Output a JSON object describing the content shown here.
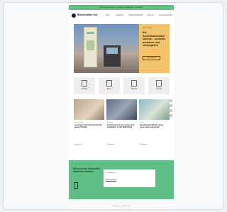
{
  "site": {
    "top_banner": "Barrierefreiheit · Leichte Sprache · Kontakt",
    "logo_text": "Bücherhallen Ost",
    "nav": [
      "Start",
      "Angebote",
      "Digitale Bibliothek",
      "Über uns",
      "Veranstaltungen"
    ]
  },
  "hero": {
    "kicker": "Neu im Haus",
    "title": "Die Ausleihautomaten sind da – schneller ausleihen und zurückgeben",
    "button": "Mehr erfahren"
  },
  "tiles": [
    {
      "label": "Katalog",
      "icon": "book-icon"
    },
    {
      "label": "Konto",
      "icon": "user-icon"
    },
    {
      "label": "Termine",
      "icon": "calendar-icon"
    },
    {
      "label": "Kontakt",
      "icon": "mail-icon"
    }
  ],
  "news": [
    {
      "kicker": "Veranstaltung",
      "title": "Lesestart: Geschichten für die ganze Familie",
      "more": "Weiterlesen"
    },
    {
      "kicker": "Aktuelles",
      "title": "Gemeinsam lesen, lernen und entdecken in der Bibliothek",
      "more": "Weiterlesen"
    },
    {
      "kicker": "Projekt",
      "title": "Kreativwerkstatt für junge Leser und Leserinnen",
      "more": "Weiterlesen"
    }
  ],
  "newsletter": {
    "title": "Mit unserem Newsletter informiert bleiben",
    "label": "E-Mail-Adresse",
    "button": "Jetzt anmelden"
  },
  "footer": {
    "text": "Impressum · Datenschutz"
  },
  "colors": {
    "accent_green": "#5fbf86",
    "hero_yellow": "#f2c36b"
  }
}
